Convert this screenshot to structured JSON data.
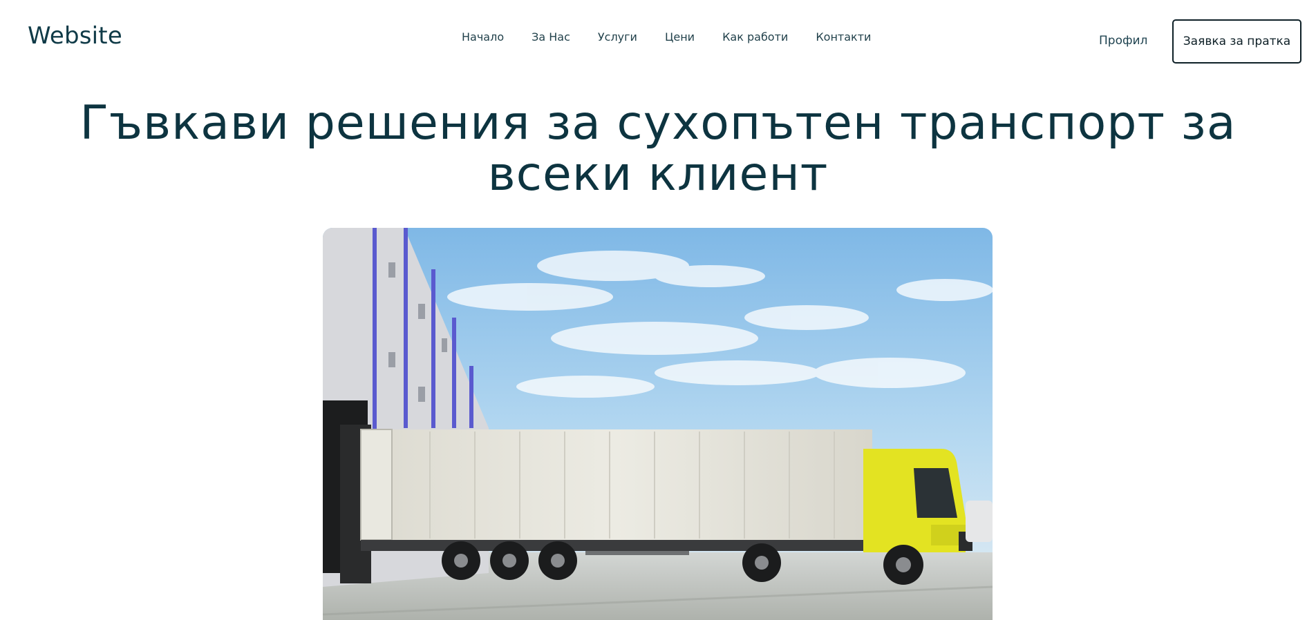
{
  "header": {
    "logo": "Website",
    "nav": [
      {
        "label": "Начало"
      },
      {
        "label": "За Нас"
      },
      {
        "label": "Услуги"
      },
      {
        "label": "Цени"
      },
      {
        "label": "Как работи"
      },
      {
        "label": "Контакти"
      }
    ],
    "profile_label": "Профил",
    "cta_label": "Заявка за пратка"
  },
  "hero": {
    "title_line1": "Гъвкави решения за сухопътен транспорт за",
    "title_line2": "всеки клиент",
    "image": {
      "subject": "white semi-trailer truck with yellow cab at warehouse loading dock",
      "colors": {
        "sky": "#8fc4ea",
        "cab": "#e3e320",
        "trailer": "#e6e4dc",
        "building": "#d9dadd",
        "building_stripes": "#5555c8",
        "ground": "#c9cbc8"
      }
    }
  },
  "colors": {
    "text_primary": "#0d3440",
    "button_border": "#0d1f26",
    "background": "#ffffff"
  }
}
